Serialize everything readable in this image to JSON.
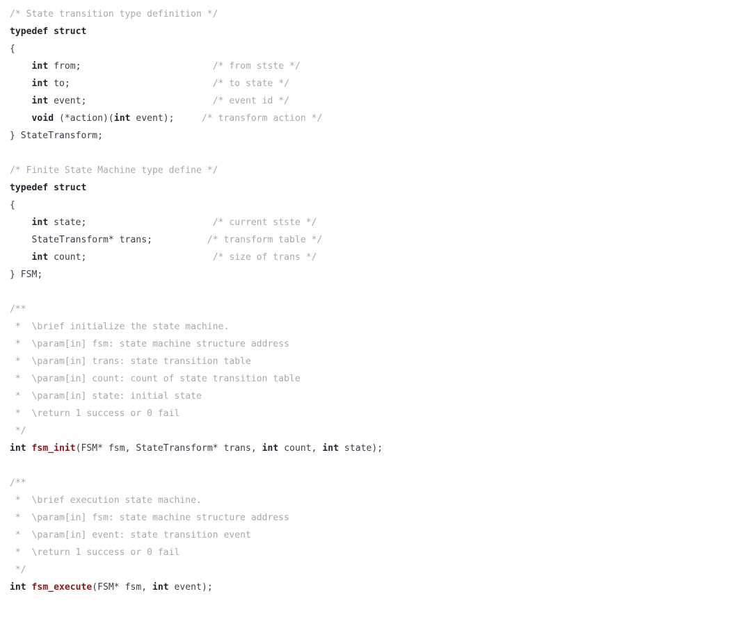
{
  "document": {
    "language": "C",
    "title": "fsm.h",
    "background_color": "#ffffff",
    "colors": {
      "comment": "#a9a9a9",
      "keyword": "#22262e",
      "function_name": "#8b1a1a",
      "identifier": "#3b4048"
    }
  },
  "code": {
    "lines": [
      {
        "n": 1,
        "tokens": [
          {
            "t": "/* State transition type definition */",
            "c": "cmt"
          }
        ]
      },
      {
        "n": 2,
        "tokens": [
          {
            "t": "typedef struct",
            "c": "kw"
          }
        ]
      },
      {
        "n": 3,
        "tokens": [
          {
            "t": "{",
            "c": "punct"
          }
        ]
      },
      {
        "n": 4,
        "tokens": [
          {
            "t": "    ",
            "c": "plain"
          },
          {
            "t": "int",
            "c": "kw"
          },
          {
            "t": " from;",
            "c": "plain"
          },
          {
            "t": "                        ",
            "c": "plain"
          },
          {
            "t": "/* from stste */",
            "c": "cmt"
          }
        ]
      },
      {
        "n": 5,
        "tokens": [
          {
            "t": "    ",
            "c": "plain"
          },
          {
            "t": "int",
            "c": "kw"
          },
          {
            "t": " to;",
            "c": "plain"
          },
          {
            "t": "                          ",
            "c": "plain"
          },
          {
            "t": "/* to state */",
            "c": "cmt"
          }
        ]
      },
      {
        "n": 6,
        "tokens": [
          {
            "t": "    ",
            "c": "plain"
          },
          {
            "t": "int",
            "c": "kw"
          },
          {
            "t": " event;",
            "c": "plain"
          },
          {
            "t": "                       ",
            "c": "plain"
          },
          {
            "t": "/* event id */",
            "c": "cmt"
          }
        ]
      },
      {
        "n": 7,
        "tokens": [
          {
            "t": "    ",
            "c": "plain"
          },
          {
            "t": "void",
            "c": "kw"
          },
          {
            "t": " (*action)(",
            "c": "plain"
          },
          {
            "t": "int",
            "c": "kw"
          },
          {
            "t": " event);",
            "c": "plain"
          },
          {
            "t": "     ",
            "c": "plain"
          },
          {
            "t": "/* transform action */",
            "c": "cmt"
          }
        ]
      },
      {
        "n": 8,
        "tokens": [
          {
            "t": "} StateTransform;",
            "c": "plain"
          }
        ]
      },
      {
        "n": 9,
        "tokens": []
      },
      {
        "n": 10,
        "tokens": [
          {
            "t": "/* Finite State Machine type define */",
            "c": "cmt"
          }
        ]
      },
      {
        "n": 11,
        "tokens": [
          {
            "t": "typedef struct",
            "c": "kw"
          }
        ]
      },
      {
        "n": 12,
        "tokens": [
          {
            "t": "{",
            "c": "punct"
          }
        ]
      },
      {
        "n": 13,
        "tokens": [
          {
            "t": "    ",
            "c": "plain"
          },
          {
            "t": "int",
            "c": "kw"
          },
          {
            "t": " state;",
            "c": "plain"
          },
          {
            "t": "                       ",
            "c": "plain"
          },
          {
            "t": "/* current stste */",
            "c": "cmt"
          }
        ]
      },
      {
        "n": 14,
        "tokens": [
          {
            "t": "    StateTransform* trans;",
            "c": "plain"
          },
          {
            "t": "          ",
            "c": "plain"
          },
          {
            "t": "/* transform table */",
            "c": "cmt"
          }
        ]
      },
      {
        "n": 15,
        "tokens": [
          {
            "t": "    ",
            "c": "plain"
          },
          {
            "t": "int",
            "c": "kw"
          },
          {
            "t": " count;",
            "c": "plain"
          },
          {
            "t": "                       ",
            "c": "plain"
          },
          {
            "t": "/* size of trans */",
            "c": "cmt"
          }
        ]
      },
      {
        "n": 16,
        "tokens": [
          {
            "t": "} FSM;",
            "c": "plain"
          }
        ]
      },
      {
        "n": 17,
        "tokens": []
      },
      {
        "n": 18,
        "tokens": [
          {
            "t": "/**",
            "c": "cmt"
          }
        ]
      },
      {
        "n": 19,
        "tokens": [
          {
            "t": " *  \\brief initialize the state machine.",
            "c": "cmt"
          }
        ]
      },
      {
        "n": 20,
        "tokens": [
          {
            "t": " *  \\param[in] fsm: state machine structure address",
            "c": "cmt"
          }
        ]
      },
      {
        "n": 21,
        "tokens": [
          {
            "t": " *  \\param[in] trans: state transition table",
            "c": "cmt"
          }
        ]
      },
      {
        "n": 22,
        "tokens": [
          {
            "t": " *  \\param[in] count: count of state transition table",
            "c": "cmt"
          }
        ]
      },
      {
        "n": 23,
        "tokens": [
          {
            "t": " *  \\param[in] state: initial state",
            "c": "cmt"
          }
        ]
      },
      {
        "n": 24,
        "tokens": [
          {
            "t": " *  \\return 1 success or 0 fail",
            "c": "cmt"
          }
        ]
      },
      {
        "n": 25,
        "tokens": [
          {
            "t": " */",
            "c": "cmt"
          }
        ]
      },
      {
        "n": 26,
        "tokens": [
          {
            "t": "int",
            "c": "kw"
          },
          {
            "t": " ",
            "c": "plain"
          },
          {
            "t": "fsm_init",
            "c": "fn"
          },
          {
            "t": "(FSM* fsm, StateTransform* trans, ",
            "c": "plain"
          },
          {
            "t": "int",
            "c": "kw"
          },
          {
            "t": " count, ",
            "c": "plain"
          },
          {
            "t": "int",
            "c": "kw"
          },
          {
            "t": " state);",
            "c": "plain"
          }
        ]
      },
      {
        "n": 27,
        "tokens": []
      },
      {
        "n": 28,
        "tokens": [
          {
            "t": "/**",
            "c": "cmt"
          }
        ]
      },
      {
        "n": 29,
        "tokens": [
          {
            "t": " *  \\brief execution state machine.",
            "c": "cmt"
          }
        ]
      },
      {
        "n": 30,
        "tokens": [
          {
            "t": " *  \\param[in] fsm: state machine structure address",
            "c": "cmt"
          }
        ]
      },
      {
        "n": 31,
        "tokens": [
          {
            "t": " *  \\param[in] event: state transition event",
            "c": "cmt"
          }
        ]
      },
      {
        "n": 32,
        "tokens": [
          {
            "t": " *  \\return 1 success or 0 fail",
            "c": "cmt"
          }
        ]
      },
      {
        "n": 33,
        "tokens": [
          {
            "t": " */",
            "c": "cmt"
          }
        ]
      },
      {
        "n": 34,
        "tokens": [
          {
            "t": "int",
            "c": "kw"
          },
          {
            "t": " ",
            "c": "plain"
          },
          {
            "t": "fsm_execute",
            "c": "fn"
          },
          {
            "t": "(FSM* fsm, ",
            "c": "plain"
          },
          {
            "t": "int",
            "c": "kw"
          },
          {
            "t": " event);",
            "c": "plain"
          }
        ]
      }
    ],
    "plain_text": [
      "/* State transition type definition */",
      "typedef struct",
      "{",
      "    int from;                        /* from stste */",
      "    int to;                          /* to state */",
      "    int event;                       /* event id */",
      "    void (*action)(int event);     /* transform action */",
      "} StateTransform;",
      "",
      "/* Finite State Machine type define */",
      "typedef struct",
      "{",
      "    int state;                       /* current stste */",
      "    StateTransform* trans;          /* transform table */",
      "    int count;                       /* size of trans */",
      "} FSM;",
      "",
      "/**",
      " *  \\brief initialize the state machine.",
      " *  \\param[in] fsm: state machine structure address",
      " *  \\param[in] trans: state transition table",
      " *  \\param[in] count: count of state transition table",
      " *  \\param[in] state: initial state",
      " *  \\return 1 success or 0 fail",
      " */",
      "int fsm_init(FSM* fsm, StateTransform* trans, int count, int state);",
      "",
      "/**",
      " *  \\brief execution state machine.",
      " *  \\param[in] fsm: state machine structure address",
      " *  \\param[in] event: state transition event",
      " *  \\return 1 success or 0 fail",
      " */",
      "int fsm_execute(FSM* fsm, int event);"
    ]
  }
}
